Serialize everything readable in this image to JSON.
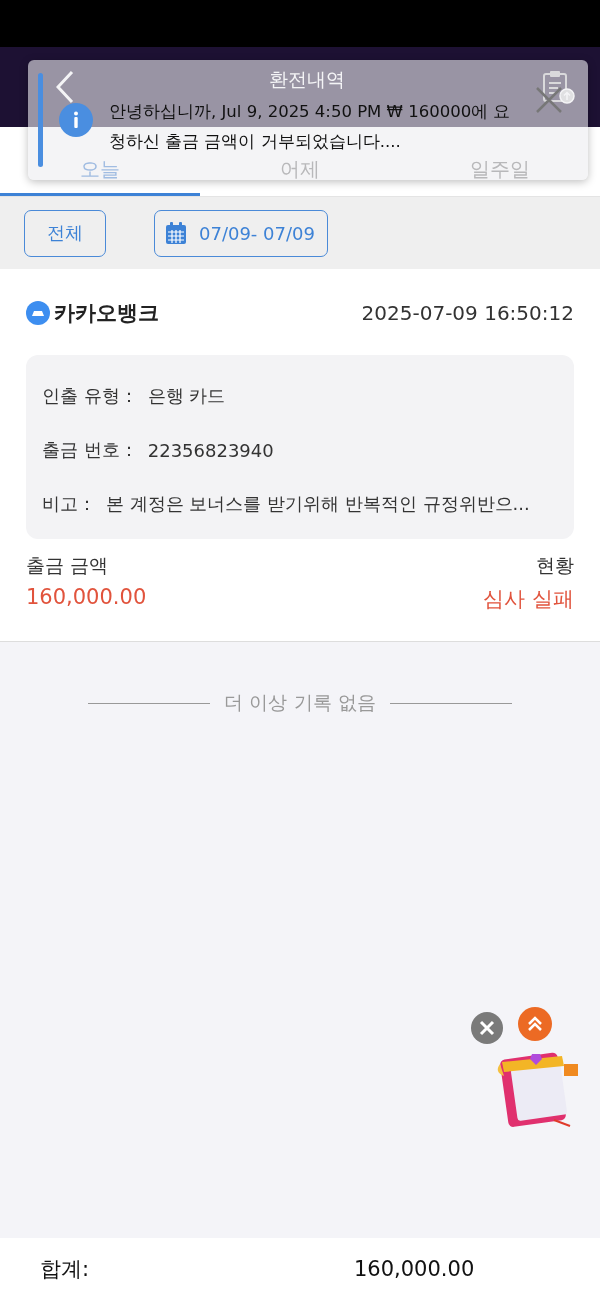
{
  "header": {
    "title": "환전내역"
  },
  "tabs": [
    {
      "label": "오늘",
      "selected": true
    },
    {
      "label": "어제",
      "selected": false
    },
    {
      "label": "일주일",
      "selected": false
    }
  ],
  "filters": {
    "all_button": "전체",
    "date_range": "07/09- 07/09"
  },
  "record": {
    "bank": "카카오뱅크",
    "timestamp": "2025-07-09 16:50:12",
    "details": [
      {
        "label": "인출 유형：",
        "value": "은행 카드"
      },
      {
        "label": "출금 번호：",
        "value": "22356823940"
      },
      {
        "label": "비고：",
        "value": "본 계정은 보너스를 받기위해 반복적인 규정위반으..."
      }
    ],
    "amount_label": "출금 금액",
    "amount": "160,000.00",
    "status_label": "현황",
    "status": "심사 실패"
  },
  "end_message": "더 이상 기록 없음",
  "footer": {
    "total_label": "합계:",
    "total": "160,000.00"
  },
  "notification": {
    "message": "안녕하십니까, Jul 9, 2025 4:50 PM ₩ 160000에 요청하신 출금 금액이 거부되었습니다...."
  }
}
